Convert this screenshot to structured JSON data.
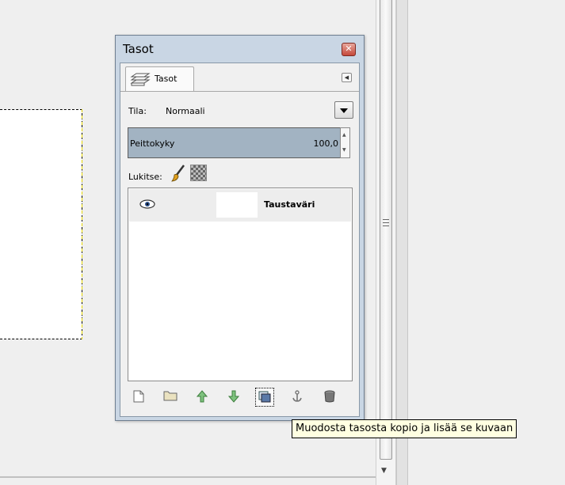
{
  "dialog": {
    "title": "Tasot",
    "tab_label": "Tasot",
    "mode_label": "Tila:",
    "mode_value": "Normaali",
    "opacity_label": "Peittokyky",
    "opacity_value": "100,0",
    "lock_label": "Lukitse:",
    "layers": [
      {
        "name": "Taustaväri",
        "visible": true
      }
    ],
    "toolbar_icons": [
      "new-layer-icon",
      "new-layer-group-icon",
      "raise-layer-icon",
      "lower-layer-icon",
      "duplicate-layer-icon",
      "anchor-layer-icon",
      "delete-layer-icon"
    ]
  },
  "tooltip": {
    "text": "Muodosta tasosta kopio ja lisää se kuvaan"
  },
  "colors": {
    "dialog_frame": "#c9d6e4",
    "opacity_fill": "#a2b3c2",
    "tooltip_bg": "#ffffe1",
    "close_button": "#c5483a"
  }
}
